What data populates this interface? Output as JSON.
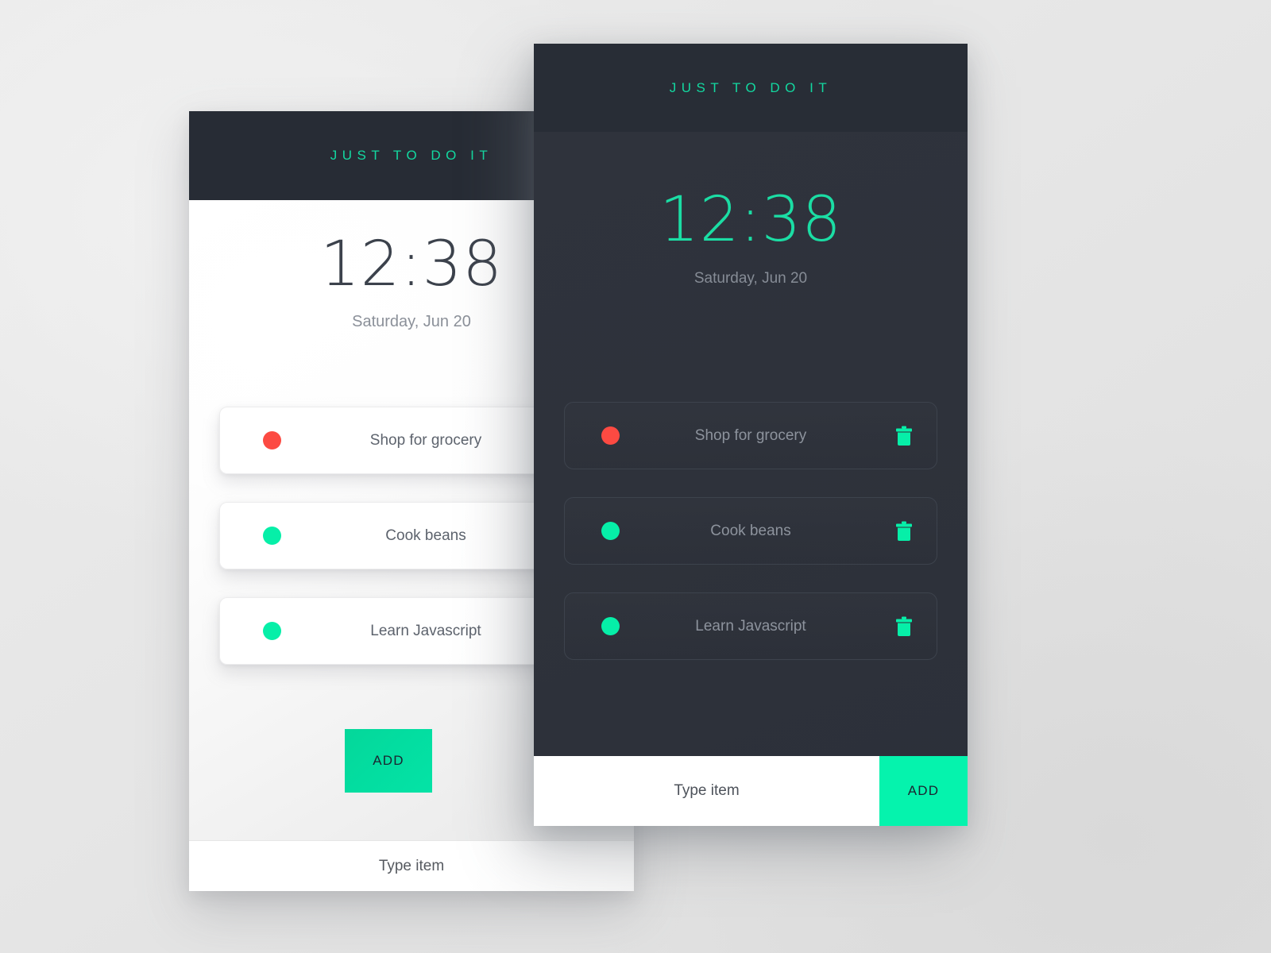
{
  "app": {
    "brand": "JUST TO DO IT",
    "accent_green": "#06f0aa",
    "accent_green_dark": "#04dca0",
    "danger_red": "#fc4a42",
    "dark_bg": "#2e323b",
    "dark_header_bg": "#282d36"
  },
  "light_card": {
    "brand": "JUST TO DO IT",
    "clock": "12:38",
    "date": "Saturday, Jun 20",
    "items": [
      {
        "label": "Shop for grocery",
        "dot_color": "#fc4a42",
        "status": "pending"
      },
      {
        "label": "Cook beans",
        "dot_color": "#06efa8",
        "status": "done"
      },
      {
        "label": "Learn Javascript",
        "dot_color": "#06efa8",
        "status": "done"
      }
    ],
    "input_placeholder": "Type item",
    "add_label": "ADD"
  },
  "dark_card": {
    "brand": "JUST TO DO IT",
    "clock": "12:38",
    "date": "Saturday, Jun 20",
    "items": [
      {
        "label": "Shop for grocery",
        "dot_color": "#fc4a42",
        "status": "pending",
        "delete_icon": "trash-icon"
      },
      {
        "label": "Cook beans",
        "dot_color": "#06efa8",
        "status": "done",
        "delete_icon": "trash-icon"
      },
      {
        "label": "Learn Javascript",
        "dot_color": "#06efa8",
        "status": "done",
        "delete_icon": "trash-icon"
      }
    ],
    "input_placeholder": "Type item",
    "add_label": "ADD"
  }
}
